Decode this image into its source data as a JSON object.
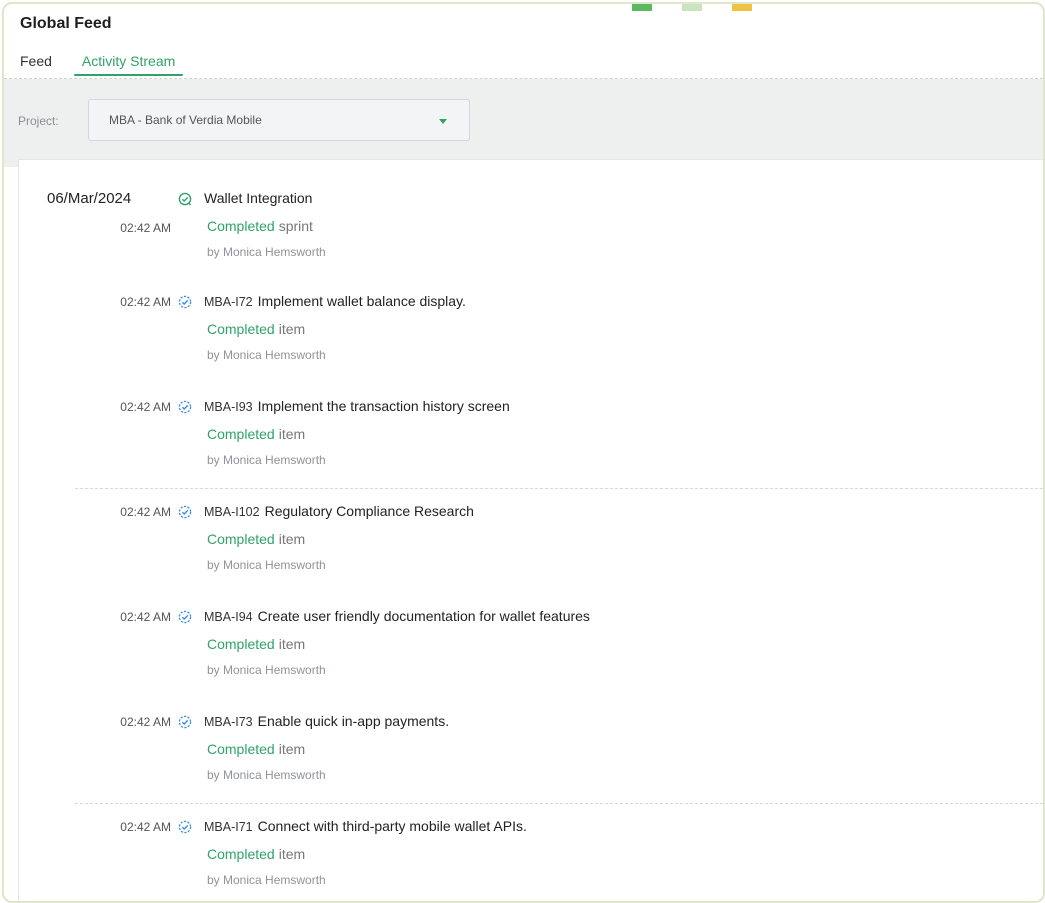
{
  "header": {
    "title": "Global Feed",
    "tabs": [
      {
        "label": "Feed",
        "active": false
      },
      {
        "label": "Activity Stream",
        "active": true
      }
    ]
  },
  "filter": {
    "label": "Project:",
    "value": "MBA - Bank of Verdia Mobile"
  },
  "colors": {
    "accent": "#2fa36a",
    "sprint_icon": "#2fa36a",
    "item_icon": "#3a8de0"
  },
  "feed": {
    "date": "06/Mar/2024",
    "entries": [
      {
        "time": "02:42 AM",
        "icon": "sprint-complete-icon",
        "key": "",
        "title": "Wallet Integration",
        "status": "Completed",
        "object": "sprint",
        "by": "by Monica Hemsworth"
      },
      {
        "time": "02:42 AM",
        "icon": "item-complete-icon",
        "key": "MBA-I72",
        "title": "Implement wallet balance display.",
        "status": "Completed",
        "object": "item",
        "by": "by Monica Hemsworth"
      },
      {
        "time": "02:42 AM",
        "icon": "item-complete-icon",
        "key": "MBA-I93",
        "title": "Implement the transaction history screen",
        "status": "Completed",
        "object": "item",
        "by": "by Monica Hemsworth"
      },
      {
        "time": "02:42 AM",
        "icon": "item-complete-icon",
        "key": "MBA-I102",
        "title": "Regulatory Compliance Research",
        "status": "Completed",
        "object": "item",
        "by": "by Monica Hemsworth"
      },
      {
        "time": "02:42 AM",
        "icon": "item-complete-icon",
        "key": "MBA-I94",
        "title": "Create user friendly documentation for wallet features",
        "status": "Completed",
        "object": "item",
        "by": "by Monica Hemsworth"
      },
      {
        "time": "02:42 AM",
        "icon": "item-complete-icon",
        "key": "MBA-I73",
        "title": "Enable quick in-app payments.",
        "status": "Completed",
        "object": "item",
        "by": "by Monica Hemsworth"
      },
      {
        "time": "02:42 AM",
        "icon": "item-complete-icon",
        "key": "MBA-I71",
        "title": "Connect with third-party mobile wallet APIs.",
        "status": "Completed",
        "object": "item",
        "by": "by Monica Hemsworth"
      }
    ]
  }
}
